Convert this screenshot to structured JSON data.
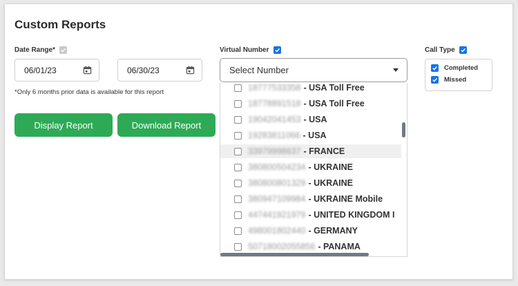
{
  "page_title": "Custom Reports",
  "date_range": {
    "label": "Date Range*",
    "start_date": "06/01/23",
    "end_date": "06/30/23",
    "note": "*Only 6 months prior data is available for this report"
  },
  "buttons": {
    "display": "Display Report",
    "download": "Download Report"
  },
  "virtual_number": {
    "label": "Virtual Number",
    "placeholder": "Select Number",
    "options": [
      {
        "number": "18777533358",
        "label": "- USA Toll Free",
        "checked": false
      },
      {
        "number": "18778891518",
        "label": "- USA Toll Free",
        "checked": false
      },
      {
        "number": "19042041453",
        "label": "- USA",
        "checked": false
      },
      {
        "number": "19283811066",
        "label": "- USA",
        "checked": false
      },
      {
        "number": "33979998637",
        "label": "- FRANCE",
        "checked": false
      },
      {
        "number": "380800504234",
        "label": "- UKRAINE",
        "checked": false
      },
      {
        "number": "380800801329",
        "label": "- UKRAINE",
        "checked": false
      },
      {
        "number": "380947109984",
        "label": "- UKRAINE Mobile",
        "checked": false
      },
      {
        "number": "447441921979",
        "label": "- UNITED KINGDOM I",
        "checked": false
      },
      {
        "number": "498001802440",
        "label": "- GERMANY",
        "checked": false
      },
      {
        "number": "50718002055856",
        "label": "- PANAMA",
        "checked": false
      }
    ]
  },
  "call_type": {
    "label": "Call Type",
    "options": [
      {
        "label": "Completed",
        "checked": true
      },
      {
        "label": "Missed",
        "checked": true
      }
    ]
  },
  "colors": {
    "primary_button": "#2eaa57",
    "checkbox_accent": "#1a73e8",
    "scrollbar": "#6f7a86"
  },
  "icons": {
    "date_picker": "calendar-icon",
    "dropdown": "caret-down-icon",
    "check": "checkmark-icon"
  }
}
